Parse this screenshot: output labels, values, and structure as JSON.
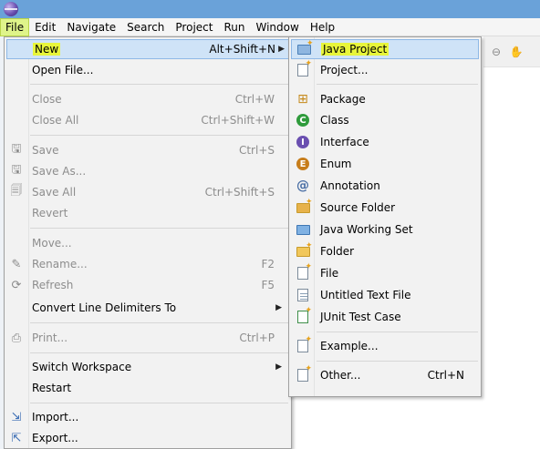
{
  "menubar": {
    "items": [
      "File",
      "Edit",
      "Navigate",
      "Search",
      "Project",
      "Run",
      "Window",
      "Help"
    ]
  },
  "file_menu": {
    "items": [
      {
        "label": "New",
        "shortcut": "Alt+Shift+N",
        "submenu": true,
        "highlight": true
      },
      {
        "label": "Open File...",
        "shortcut": ""
      },
      {
        "label": "Close",
        "shortcut": "Ctrl+W",
        "disabled": true
      },
      {
        "label": "Close All",
        "shortcut": "Ctrl+Shift+W",
        "disabled": true
      },
      {
        "label": "Save",
        "shortcut": "Ctrl+S",
        "disabled": true,
        "icon": "save-icon"
      },
      {
        "label": "Save As...",
        "shortcut": "",
        "disabled": true,
        "icon": "save-as-icon"
      },
      {
        "label": "Save All",
        "shortcut": "Ctrl+Shift+S",
        "disabled": true,
        "icon": "save-all-icon"
      },
      {
        "label": "Revert",
        "shortcut": "",
        "disabled": true
      },
      {
        "label": "Move...",
        "shortcut": "",
        "disabled": true
      },
      {
        "label": "Rename...",
        "shortcut": "F2",
        "disabled": true,
        "icon": "rename-icon"
      },
      {
        "label": "Refresh",
        "shortcut": "F5",
        "disabled": true,
        "icon": "refresh-icon"
      },
      {
        "label": "Convert Line Delimiters To",
        "shortcut": "",
        "submenu": true
      },
      {
        "label": "Print...",
        "shortcut": "Ctrl+P",
        "disabled": true,
        "icon": "print-icon"
      },
      {
        "label": "Switch Workspace",
        "shortcut": "",
        "submenu": true
      },
      {
        "label": "Restart",
        "shortcut": ""
      },
      {
        "label": "Import...",
        "shortcut": "",
        "icon": "import-icon"
      },
      {
        "label": "Export...",
        "shortcut": "",
        "icon": "export-icon"
      }
    ]
  },
  "new_submenu": {
    "items": [
      {
        "label": "Java Project",
        "highlight": true,
        "icon": "java-project-icon"
      },
      {
        "label": "Project...",
        "icon": "project-icon"
      },
      {
        "label": "Package",
        "icon": "package-icon"
      },
      {
        "label": "Class",
        "icon": "class-icon"
      },
      {
        "label": "Interface",
        "icon": "interface-icon"
      },
      {
        "label": "Enum",
        "icon": "enum-icon"
      },
      {
        "label": "Annotation",
        "icon": "annotation-icon"
      },
      {
        "label": "Source Folder",
        "icon": "source-folder-icon"
      },
      {
        "label": "Java Working Set",
        "icon": "working-set-icon"
      },
      {
        "label": "Folder",
        "icon": "folder-icon"
      },
      {
        "label": "File",
        "icon": "file-icon"
      },
      {
        "label": "Untitled Text File",
        "icon": "text-file-icon"
      },
      {
        "label": "JUnit Test Case",
        "icon": "junit-icon"
      },
      {
        "label": "Example...",
        "icon": "example-icon"
      },
      {
        "label": "Other...",
        "shortcut": "Ctrl+N",
        "icon": "other-icon"
      }
    ]
  },
  "colors": {
    "highlight_marker": "#e8f53a",
    "hover_background": "#cfe3f7",
    "menu_background": "#f2f2f2"
  }
}
